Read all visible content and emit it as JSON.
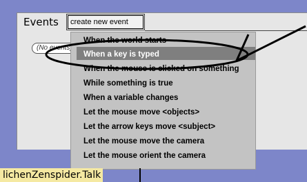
{
  "events_panel": {
    "title": "Events",
    "create_button_label": "create new event",
    "no_events_text": "(No events)"
  },
  "menu": {
    "items": [
      "When the world starts",
      "When a key is typed",
      "When the mouse is clicked on something",
      "While something is true",
      "When a variable changes",
      "Let the mouse move <objects>",
      "Let the arrow keys move <subject>",
      "Let the mouse move the camera",
      "Let the mouse orient the camera"
    ],
    "highlighted_index": 1
  },
  "object_label": "lichenZenspider.Talk",
  "colors": {
    "app_background": "#7d86c9",
    "panel_background": "#e6e6e6",
    "menu_background": "#c3c3c3",
    "menu_highlight": "#7f7f7f",
    "label_background": "#f5e9a2",
    "annotation": "#000000"
  }
}
